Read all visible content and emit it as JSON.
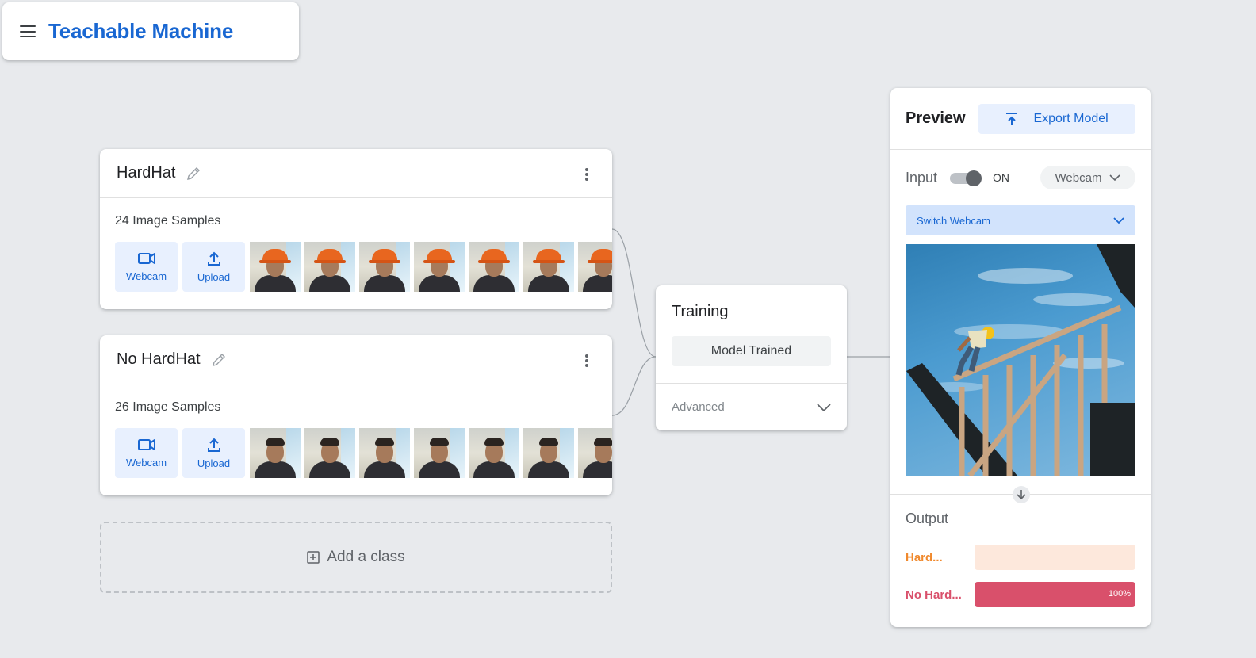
{
  "app": {
    "title": "Teachable Machine"
  },
  "classes": [
    {
      "name": "HardHat",
      "samples_label": "24 Image Samples",
      "webcam_label": "Webcam",
      "upload_label": "Upload"
    },
    {
      "name": "No HardHat",
      "samples_label": "26 Image Samples",
      "webcam_label": "Webcam",
      "upload_label": "Upload"
    }
  ],
  "add_class_label": "Add a class",
  "training": {
    "title": "Training",
    "button_label": "Model Trained",
    "advanced_label": "Advanced"
  },
  "preview": {
    "title": "Preview",
    "export_label": "Export Model",
    "input_label": "Input",
    "toggle_state": "ON",
    "source_select": "Webcam",
    "switch_webcam_label": "Switch Webcam",
    "output_title": "Output",
    "outputs": [
      {
        "label": "Hard...",
        "value": 0.0,
        "percent_text": "",
        "color": "#f0892d",
        "track_color": "#fde8dc"
      },
      {
        "label": "No Hard...",
        "value": 1.0,
        "percent_text": "100%",
        "color": "#d9506b",
        "track_color": "#fbe3e8"
      }
    ]
  },
  "colors": {
    "accent": "#1967d2",
    "accent_light": "#e8f0fe",
    "background": "#e8eaed"
  }
}
